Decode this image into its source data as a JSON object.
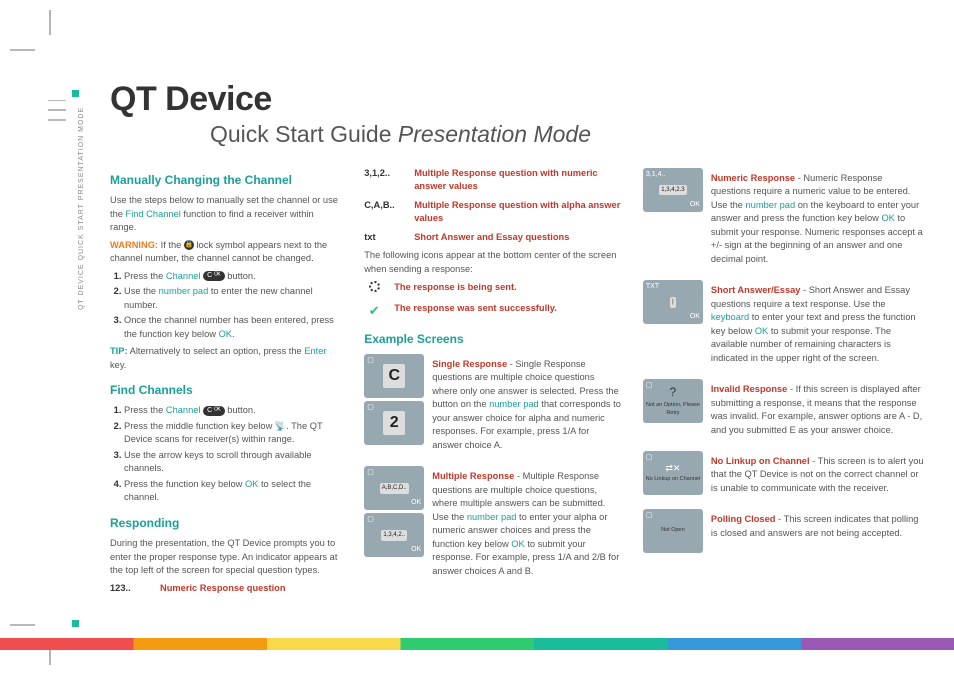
{
  "title": "QT Device",
  "subtitle_plain": "Quick Start Guide ",
  "subtitle_em": "Presentation Mode",
  "side_label": "QT DEVICE  QUICK START  PRESENTATION MODE",
  "col1": {
    "h1": "Manually Changing the Channel",
    "p1a": "Use the steps below to manually set the channel or use the ",
    "p1_link": "Find Channel",
    "p1b": " function to find a receiver within range.",
    "warn_label": "WARNING:",
    "warn_a": " If the ",
    "warn_b": " lock symbol appears next to the channel number, the channel cannot be changed.",
    "s1a": "Press the ",
    "s1_link": "Channel",
    "s1b": " button.",
    "s2a": "Use the ",
    "s2_link": "number pad",
    "s2b": " to enter the new channel number.",
    "s3a": "Once the channel number has been entered, press the function key below ",
    "s3_link": "OK",
    "s3b": ".",
    "tip_label": "TIP:",
    "tip_a": " Alternatively to select an option, press the ",
    "tip_link": "Enter",
    "tip_b": " key.",
    "h2": "Find Channels",
    "f1a": "Press the ",
    "f1_link": "Channel",
    "f1b": " button.",
    "f2a": "Press the middle function key below ",
    "f2b": ". The QT Device scans for receiver(s) within range.",
    "f3": "Use the arrow keys to scroll through available channels.",
    "f4a": "Press the function key below ",
    "f4_link": "OK",
    "f4b": " to select the channel.",
    "h3": "Responding",
    "p3": "During the presentation, the QT Device prompts you to enter the proper response type. An indicator appears at the top left of the screen for special question types.",
    "leg1_key": "123..",
    "leg1_txt": "Numeric Response question"
  },
  "col2": {
    "leg2_key": "3,1,2..",
    "leg2_txt": "Multiple Response question with numeric answer values",
    "leg3_key": "C,A,B..",
    "leg3_txt": "Multiple Response question with alpha answer values",
    "leg4_key": "txt",
    "leg4_txt": "Short Answer and Essay questions",
    "p1": "The following icons appear at the bottom center of the screen when sending a response:",
    "ic1": "The response is being sent.",
    "ic2": "The response was sent successfully.",
    "h1": "Example Screens",
    "sr_title": "Single Response",
    "sr_body": "  -  Single Response questions are multiple choice questions where only one answer is selected. Press the button on the ",
    "sr_link": "number pad",
    "sr_body2": " that corresponds to your answer choice for alpha and numeric responses. For example, press 1/A for answer choice A.",
    "mr_title": "Multiple Response",
    "mr_body": "  -  Multiple Response questions are multiple choice questions, where multiple answers can be submitted. Use the ",
    "mr_link": "number pad",
    "mr_body2": " to enter your alpha or numeric answer choices and press the function key below ",
    "mr_link2": "OK",
    "mr_body3": " to submit your response. For example, press 1/A and 2/B for answer choices A and B."
  },
  "col3": {
    "nr_title": "Numeric Response",
    "nr_body1": "  -  Numeric Response questions require a numeric value to be entered. Use the ",
    "nr_link1": "number pad",
    "nr_body2": " on the keyboard to enter your answer and press the function key below ",
    "nr_link2": "OK",
    "nr_body3": " to submit your response. Numeric responses accept a +/- sign at the beginning of an answer and one decimal point.",
    "sa_title": "Short Answer/Essay",
    "sa_body1": "  -  Short Answer and Essay questions require a text response. Use the ",
    "sa_link1": "keyboard",
    "sa_body2": " to enter your text and press the function key below ",
    "sa_link2": "OK",
    "sa_body3": " to submit your response. The available number of remaining characters is indicated in the upper right of the screen.",
    "iv_title": "Invalid Response",
    "iv_body": "  -  If this screen is displayed after submitting a response, it means that the response was invalid. For example, answer options are A - D, and you submitted E as your answer choice.",
    "nl_title": "No Linkup on Channel",
    "nl_body": "  -  This screen is to alert you that the QT Device is not on the correct channel or is unable to communicate with the receiver.",
    "pc_title": "Polling Closed",
    "pc_body": "  -  This screen indicates that polling is closed and answers are not being accepted."
  },
  "thumbs": {
    "c": "C",
    "two": "2",
    "abcd": "A,B,C,D..",
    "nums": "1,3,4,2..",
    "n_top": "3,1,4..",
    "n_val": "1,3,4,2.3",
    "ok": "OK",
    "txt": "TXT",
    "bar": "|",
    "q": "?",
    "inv": "Not an Option, Please Retry",
    "nolink": "No Linkup on Channel",
    "closed": "Not Open"
  }
}
